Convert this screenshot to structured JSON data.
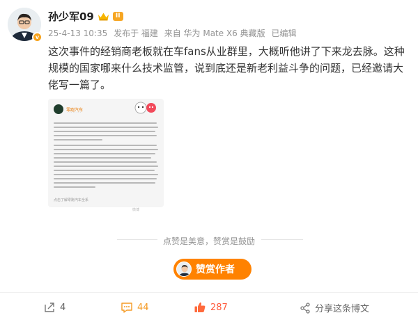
{
  "post": {
    "username": "孙少军09",
    "level": "II",
    "verified_badge": "v",
    "meta": {
      "date": "25-4-13 10:35",
      "source": "发布于 福建",
      "device": "来自 华为 Mate X6 典藏版",
      "edited": "已编辑"
    },
    "text": "这次事件的经销商老板就在车fans从业群里，大概听他讲了下来龙去脉。这种规模的国家哪来什么技术监管，说到底还是新老利益斗争的问题，已经邀请大佬写一篇了。",
    "embedded_image": {
      "account": "零跑汽车",
      "footer": "点击了解零跑汽车全系",
      "watermark": "微博"
    }
  },
  "praise": {
    "text": "点赞是美意，赞赏是鼓励",
    "button_label": "赞赏作者"
  },
  "actions": {
    "share_count": "4",
    "comment_count": "44",
    "like_count": "287",
    "forward_label": "分享这条博文"
  },
  "colors": {
    "orange": "#ff8200",
    "comment": "#f59a23",
    "like": "#ff5a3c",
    "meta_gray": "#939393"
  }
}
